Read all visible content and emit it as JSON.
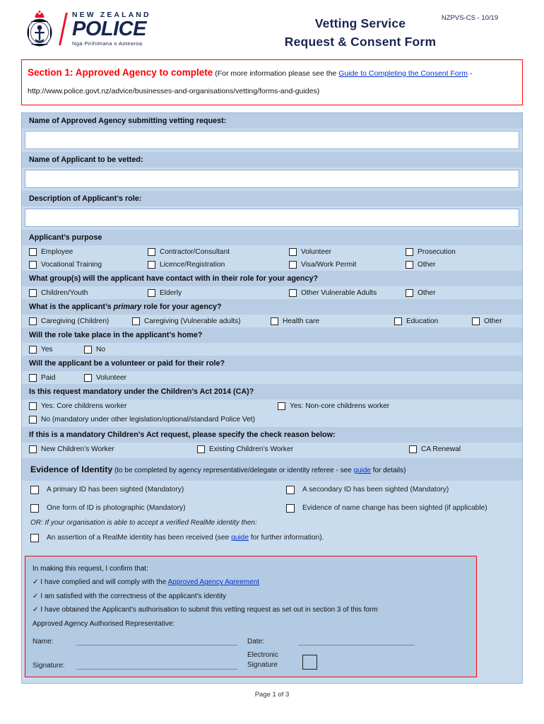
{
  "header": {
    "logo": {
      "nz": "NEW ZEALAND",
      "police": "POLICE",
      "maori": "Nga Pirihimana o Aotearoa",
      "crest_icon": "nz-police-crest-icon"
    },
    "title_line1": "Vetting Service",
    "title_line2": "Request & Consent Form",
    "doc_code": "NZPVS-CS - 10/19"
  },
  "section1": {
    "title": "Section 1:  Approved Agency to complete",
    "note_pre": " (For more information please see the ",
    "link1": "Guide to Completing the Consent Form",
    "note_post": " - http://www.police.govt.nz/advice/businesses-and-organisations/vetting/forms-and-guides)"
  },
  "fields": [
    {
      "label": "Name of Approved Agency submitting vetting request:",
      "value": ""
    },
    {
      "label": "Name of Applicant to be vetted:",
      "value": ""
    },
    {
      "label": "Description of Applicant’s role:",
      "value": ""
    }
  ],
  "purpose": {
    "heading": "Applicant’s purpose",
    "row1": [
      "Employee",
      "Contractor/Consultant",
      "Volunteer",
      "Prosecution"
    ],
    "row2": [
      "Vocational Training",
      "Licence/Registration",
      "Visa/Work Permit",
      "Other"
    ]
  },
  "contact_groups": {
    "heading": "What group(s) will the applicant have contact with in their role for your agency?",
    "options": [
      "Children/Youth",
      "Elderly",
      "Other Vulnerable Adults",
      "Other"
    ]
  },
  "primary_role": {
    "heading_pre": "What is the applicant’s ",
    "heading_em": "primary",
    "heading_post": " role for your agency?",
    "options": [
      "Caregiving (Children)",
      "Caregiving (Vulnerable adults)",
      "Health care",
      "Education",
      "Other"
    ]
  },
  "home_role": {
    "heading": "Will the role take place in the applicant’s home?",
    "options": [
      "Yes",
      "No"
    ]
  },
  "paid_role": {
    "heading": "Will the applicant be a volunteer or paid for their role?",
    "options": [
      "Paid",
      "Volunteer"
    ]
  },
  "childrens_act": {
    "heading": "Is this request mandatory under the Children’s Act 2014 (CA)?",
    "option_yes_core": "Yes: Core childrens worker",
    "option_yes_noncore": "Yes: Non-core childrens worker",
    "option_no": "No (mandatory under other legislation/optional/standard Police Vet)"
  },
  "check_reason": {
    "heading": "If this is a mandatory Children’s Act request, please specify the check reason below:",
    "options": [
      "New Children’s Worker",
      "Existing Children’s Worker",
      "CA Renewal"
    ]
  },
  "evidence_of_identity": {
    "heading_bold": "Evidence of Identity",
    "heading_pre": " (to be completed by agency representative/delegate or identity referee - see ",
    "heading_link": "guide",
    "heading_post": " for details)",
    "row1_left": "A primary ID has been sighted (Mandatory)",
    "row1_right": "A secondary ID has been sighted (Mandatory)",
    "row2_left": "One form of ID is photographic (Mandatory)",
    "row2_right": "Evidence of name change has been sighted (if applicable)",
    "or_line": "OR: If your organisation is able to accept a verified RealMe identity then:",
    "realme_pre": "An assertion of a RealMe identity has been received (see ",
    "realme_link": "guide",
    "realme_post": " for further information)."
  },
  "declaration": {
    "intro": "In making this request, I confirm that:",
    "tick": "✓",
    "item1_pre": "I have complied and will comply with the ",
    "item1_link": "Approved Agency Agreement",
    "item2": "I am satisfied with the correctness of the applicant’s identity",
    "item3": "I have obtained the Applicant’s authorisation to submit this vetting request as set out in section 3 of this form",
    "rep_label": "Approved Agency Authorised Representative:",
    "name_label": "Name:",
    "name_value": "",
    "date_label": "Date:",
    "date_value": "",
    "signature_label": "Signature:",
    "signature_value": "",
    "esig_label_line1": "Electronic",
    "esig_label_line2": "Signature"
  },
  "footer": {
    "page_text": "Page 1 of 3"
  },
  "colors": {
    "police_navy": "#16264f",
    "alert_red": "#ff0000",
    "bar_blue": "#b8cce4",
    "body_blue": "#c9dcee",
    "decl_blue": "#b2cae2",
    "link_blue": "#0033cc"
  }
}
